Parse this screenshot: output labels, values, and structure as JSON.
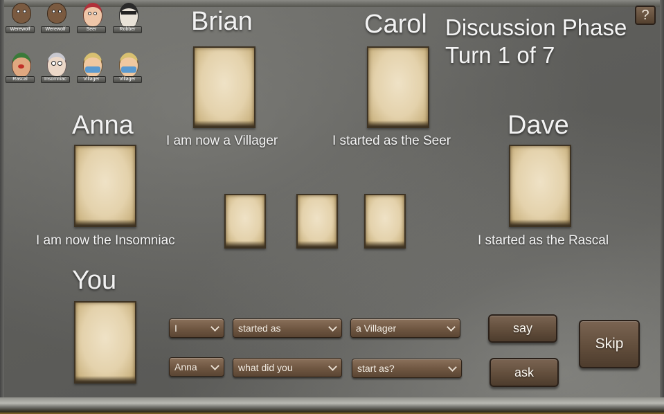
{
  "phase": {
    "title": "Discussion Phase",
    "turn": "Turn 1 of 7"
  },
  "help_label": "?",
  "roles": [
    {
      "label": "Werewolf",
      "color": "#7a5a40"
    },
    {
      "label": "Werewolf",
      "color": "#7a5a40"
    },
    {
      "label": "Seer",
      "color": "#e0b090"
    },
    {
      "label": "Robber",
      "color": "#3a3a3a"
    },
    {
      "label": "Rascal",
      "color": "#3a7a3a"
    },
    {
      "label": "Insomniac",
      "color": "#d8d8e0"
    },
    {
      "label": "Villager",
      "color": "#5a9ad0"
    },
    {
      "label": "Villager",
      "color": "#5a9ad0"
    }
  ],
  "players": {
    "brian": {
      "name": "Brian",
      "claim": "I am now a Villager"
    },
    "carol": {
      "name": "Carol",
      "claim": "I started as the Seer"
    },
    "anna": {
      "name": "Anna",
      "claim": "I am now the Insomniac"
    },
    "dave": {
      "name": "Dave",
      "claim": "I started as the Rascal"
    },
    "you": {
      "name": "You"
    }
  },
  "statement": {
    "subject": "I",
    "verb": "started as",
    "object": "a Villager",
    "say_label": "say"
  },
  "question": {
    "target": "Anna",
    "verb": "what did you",
    "object": "start as?",
    "ask_label": "ask"
  },
  "skip_label": "Skip"
}
